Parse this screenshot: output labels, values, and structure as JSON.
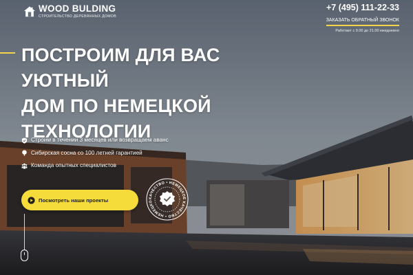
{
  "header": {
    "logo_title": "WOOD BULDING",
    "logo_subtitle": "СТРОИТЕЛЬСТВО ДЕРЕВЯННЫХ ДОМОВ",
    "phone": "+7 (495) 111-22-33",
    "callback_label": "ЗАКАЗАТЬ ОБРАТНЫЙ ЗВОНОК",
    "hours": "Работает с 9.00 до 21.00 ежедневно"
  },
  "hero": {
    "headline_lines": [
      "ПОСТРОИМ ДЛЯ ВАС УЮТНЫЙ",
      "ДОМ ПО НЕМЕЦКОЙ",
      "ТЕХНОЛОГИИ"
    ],
    "features": [
      {
        "icon": "shield-icon",
        "text": "Строим в течении 3 месяцев или возвращаем аванс"
      },
      {
        "icon": "tree-icon",
        "text": "Сибирская сосна со 100 летней гарантией"
      },
      {
        "icon": "team-icon",
        "text": "Команда опытных специалистов"
      }
    ],
    "cta_label": "Посмотреть наши проекты",
    "badge_text": "КАЧЕСТВО • НЕМЕЦКОЕ КАЧЕСТВО • НЕМЕЦКОЕ"
  },
  "colors": {
    "accent": "#f5dc3a",
    "text": "#ffffff"
  }
}
